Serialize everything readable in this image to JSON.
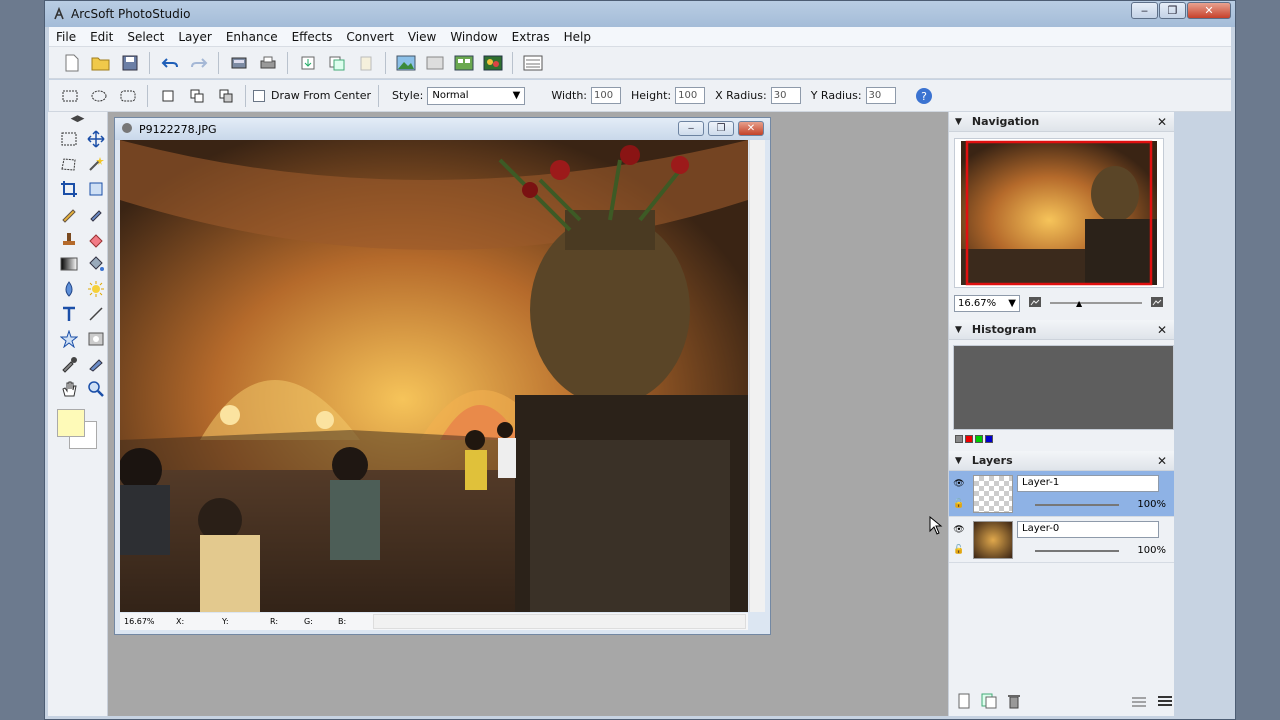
{
  "window": {
    "title": "ArcSoft PhotoStudio"
  },
  "menu": [
    "File",
    "Edit",
    "Select",
    "Layer",
    "Enhance",
    "Effects",
    "Convert",
    "View",
    "Window",
    "Extras",
    "Help"
  ],
  "options": {
    "draw_from_center": "Draw From Center",
    "style_label": "Style:",
    "style_value": "Normal",
    "width_label": "Width:",
    "width_value": "100",
    "height_label": "Height:",
    "height_value": "100",
    "xradius_label": "X Radius:",
    "xradius_value": "30",
    "yradius_label": "Y Radius:",
    "yradius_value": "30"
  },
  "document": {
    "filename": "P9122278.JPG",
    "zoom": "16.67%",
    "status_x": "X:",
    "status_y": "Y:",
    "status_r": "R:",
    "status_g": "G:",
    "status_b": "B:"
  },
  "navigation": {
    "title": "Navigation",
    "zoom": "16.67%"
  },
  "histogram": {
    "title": "Histogram"
  },
  "layers": {
    "title": "Layers",
    "items": [
      {
        "name": "Layer-1",
        "opacity": "100%"
      },
      {
        "name": "Layer-0",
        "opacity": "100%"
      }
    ]
  },
  "colors": {
    "foreground": "#fefab8",
    "background": "#ffffff",
    "accent": "#8eb2e5"
  }
}
